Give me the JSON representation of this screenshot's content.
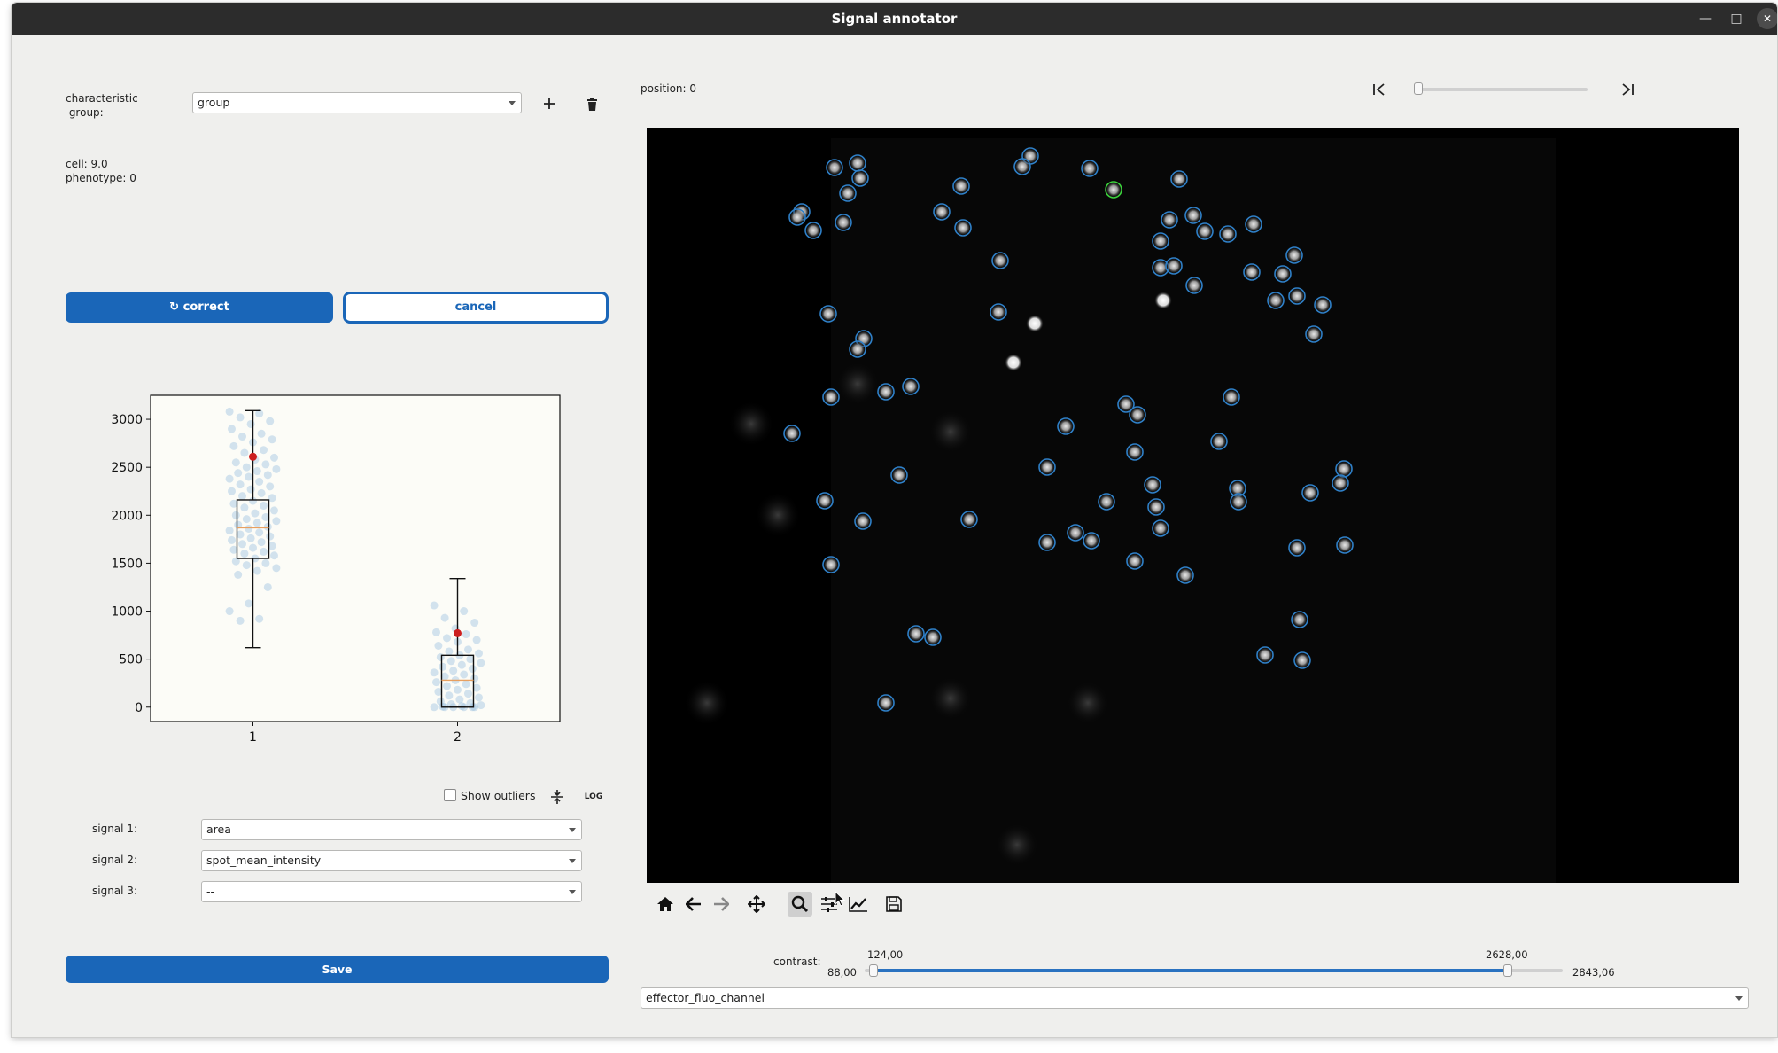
{
  "window": {
    "title": "Signal annotator"
  },
  "left_panel": {
    "characteristic_label": "characteristic\n group:",
    "group_select": "group",
    "add_icon": "plus-icon",
    "delete_icon": "trash-icon",
    "cell_info": "cell: 9.0",
    "phenotype_info": "phenotype: 0",
    "correct_button": "correct",
    "cancel_button": "cancel",
    "show_outliers_label": "Show outliers",
    "log_label": "LOG",
    "signals": [
      {
        "label": "signal 1:",
        "value": "area"
      },
      {
        "label": "signal 2:",
        "value": "spot_mean_intensity"
      },
      {
        "label": "signal 3:",
        "value": "--"
      }
    ],
    "save_button": "Save"
  },
  "chart_data": {
    "type": "box",
    "categories": [
      "1",
      "2"
    ],
    "y_ticks": [
      "0",
      "500",
      "1000",
      "1500",
      "2000",
      "2500",
      "3000"
    ],
    "ylim": [
      -150,
      3250
    ],
    "boxes": [
      {
        "name": "1",
        "q1": 1550,
        "median": 1870,
        "q3": 2160,
        "whisker_low": 620,
        "whisker_high": 3090,
        "highlight": 2610
      },
      {
        "name": "2",
        "q1": 0,
        "median": 280,
        "q3": 540,
        "whisker_low": 0,
        "whisker_high": 1340,
        "highlight": 770
      }
    ],
    "points": [
      {
        "group": 1,
        "values": [
          3080,
          3060,
          3020,
          2980,
          2950,
          2900,
          2850,
          2820,
          2790,
          2760,
          2720,
          2680,
          2650,
          2600,
          2580,
          2550,
          2530,
          2500,
          2480,
          2460,
          2440,
          2420,
          2400,
          2380,
          2350,
          2320,
          2300,
          2270,
          2250,
          2230,
          2200,
          2180,
          2150,
          2120,
          2100,
          2080,
          2050,
          2020,
          2000,
          1980,
          1960,
          1940,
          1920,
          1900,
          1880,
          1860,
          1840,
          1820,
          1800,
          1780,
          1760,
          1740,
          1720,
          1700,
          1680,
          1660,
          1640,
          1620,
          1600,
          1580,
          1550,
          1520,
          1500,
          1480,
          1450,
          1420,
          1380,
          1250,
          1080,
          1000,
          920,
          900
        ]
      },
      {
        "group": 2,
        "values": [
          1060,
          1000,
          930,
          880,
          820,
          780,
          760,
          720,
          700,
          680,
          640,
          600,
          580,
          560,
          540,
          520,
          500,
          480,
          460,
          440,
          420,
          400,
          380,
          360,
          340,
          320,
          300,
          280,
          260,
          240,
          220,
          200,
          180,
          160,
          140,
          120,
          100,
          80,
          60,
          40,
          30,
          20,
          10,
          5,
          0,
          0,
          0,
          0,
          0,
          0
        ]
      }
    ],
    "colors": {
      "box": "#000000",
      "median": "#e8a060",
      "points": "#9fc3e0",
      "highlight": "#cc1f1f",
      "bg": "#fcfcf7"
    }
  },
  "viewer": {
    "position_label": "position: 0",
    "first_icon": "skip-first-icon",
    "last_icon": "skip-last-icon",
    "contrast_label": "contrast:",
    "contrast_low": "124,00",
    "contrast_high": "2628,00",
    "contrast_min": "88,00",
    "contrast_max": "2843,06",
    "contrast_range": [
      88.0,
      2843.06
    ],
    "contrast_values": [
      124.0,
      2628.0
    ],
    "channel_select": "effector_fluo_channel",
    "toolbar_icons": [
      "home-icon",
      "back-icon",
      "forward-icon",
      "pan-icon",
      "zoom-icon",
      "configure-icon",
      "axes-edit-icon",
      "save-figure-icon"
    ]
  }
}
